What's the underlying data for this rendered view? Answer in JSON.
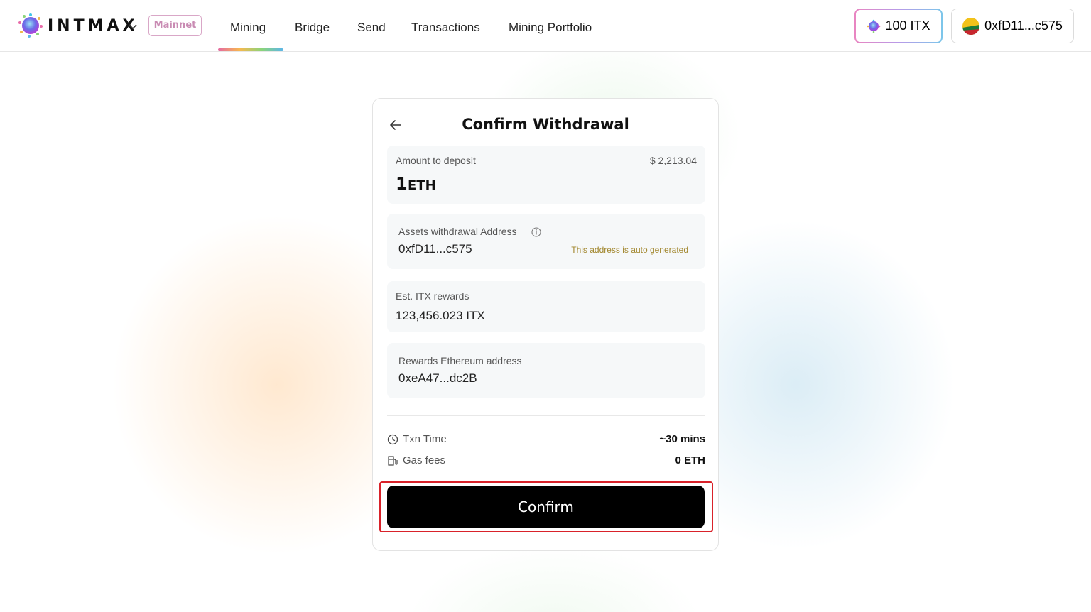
{
  "header": {
    "logo_text": "INTMAX",
    "network_badge": "Mainnet",
    "nav": [
      "Mining",
      "Bridge",
      "Send",
      "Transactions",
      "Mining Portfolio"
    ],
    "active_nav": "Mining",
    "balance_label": "100 ITX",
    "wallet_label": "0xfD11...c575"
  },
  "card": {
    "title": "Confirm Withdrawal",
    "amount": {
      "label": "Amount to deposit",
      "usd_value": "$ 2,213.04",
      "value": "1",
      "unit": "ETH"
    },
    "withdrawal_address": {
      "label": "Assets withdrawal Address",
      "value": "0xfD11...c575",
      "note": "This address is auto generated"
    },
    "rewards": {
      "label": "Est. ITX rewards",
      "value": "123,456.023 ITX"
    },
    "rewards_address": {
      "label": "Rewards Ethereum address",
      "value": "0xeA47...dc2B"
    },
    "txn_time": {
      "label": "Txn Time",
      "value": "~30 mins"
    },
    "gas_fees": {
      "label": "Gas fees",
      "value": "0 ETH"
    },
    "confirm_label": "Confirm"
  },
  "colors": {
    "confirm_bg": "#000000",
    "highlight_outline": "#d9222a",
    "auto_note": "#a2872e"
  }
}
